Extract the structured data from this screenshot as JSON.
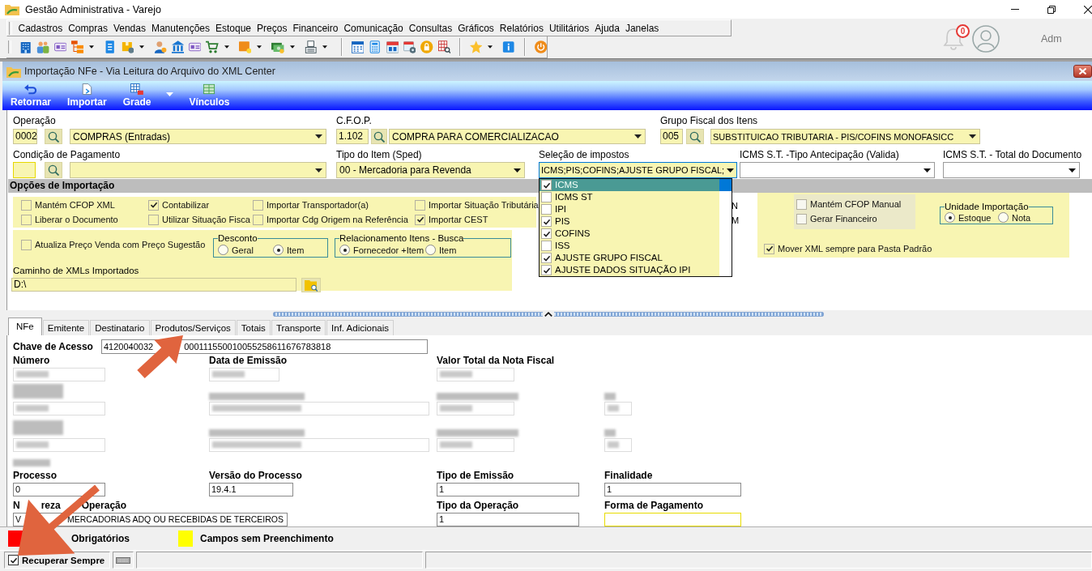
{
  "app": {
    "title": "Gestão Administrativa - Varejo"
  },
  "menu": [
    "Cadastros",
    "Compras",
    "Vendas",
    "Manutenções",
    "Estoque",
    "Preços",
    "Financeiro",
    "Comunicação",
    "Consultas",
    "Gráficos",
    "Relatórios",
    "Utilitários",
    "Ajuda",
    "Janelas"
  ],
  "notifications": {
    "count": "0"
  },
  "user": {
    "name": "Adm"
  },
  "window": {
    "title": "Importação NFe - Via Leitura do Arquivo do XML Center"
  },
  "actions": [
    {
      "label": "Retornar",
      "dropdown": false
    },
    {
      "label": "Importar",
      "dropdown": false
    },
    {
      "label": "Grade",
      "dropdown": true
    },
    {
      "label": "Vínculos",
      "dropdown": false
    }
  ],
  "operacao": {
    "label": "Operação",
    "code": "0002",
    "value": "COMPRAS (Entradas)"
  },
  "cfop": {
    "label": "C.F.O.P.",
    "code": "1.102",
    "value": "COMPRA PARA COMERCIALIZACAO"
  },
  "grupo_fiscal": {
    "label": "Grupo Fiscal dos Itens",
    "code": "005",
    "value": "SUBSTITUICAO TRIBUTARIA - PIS/COFINS MONOFASICC"
  },
  "condicao_pagamento": {
    "label": "Condição de Pagamento"
  },
  "tipo_item": {
    "label": "Tipo do Item (Sped)",
    "value": "00 - Mercadoria para Revenda"
  },
  "impostos": {
    "label": "Seleção de impostos",
    "value": "ICMS;PIS;COFINS;AJUSTE GRUPO FISCAL;",
    "expanded": true,
    "options": [
      {
        "label": "ICMS",
        "checked": true,
        "selected": true
      },
      {
        "label": "ICMS ST",
        "checked": false,
        "selected": false
      },
      {
        "label": "IPI",
        "checked": false,
        "selected": false
      },
      {
        "label": "PIS",
        "checked": true,
        "selected": false
      },
      {
        "label": "COFINS",
        "checked": true,
        "selected": false
      },
      {
        "label": "ISS",
        "checked": false,
        "selected": false
      },
      {
        "label": "AJUSTE GRUPO FISCAL",
        "checked": true,
        "selected": false
      },
      {
        "label": "AJUSTE DADOS SITUAÇÃO IPI",
        "checked": true,
        "selected": false
      }
    ]
  },
  "icms_st_tipo": {
    "label": "ICMS S.T. -Tipo Antecipação (Valida)"
  },
  "icms_st_total": {
    "label": "ICMS S.T. - Total do Documento"
  },
  "opcoes": {
    "title": "Opções de Importação",
    "checks": [
      {
        "label": "Mantém CFOP XML",
        "checked": false
      },
      {
        "label": "Contabilizar",
        "checked": true
      },
      {
        "label": "Importar Transportador(a)",
        "checked": false
      },
      {
        "label": "Importar Situação Tributária",
        "checked": false
      },
      {
        "label": "Liberar o Documento",
        "checked": false
      },
      {
        "label": "Utilizar Situação Fisca",
        "checked": false
      },
      {
        "label": "Importar Cdg Origem na Referência",
        "checked": false
      },
      {
        "label": "Importar CEST",
        "checked": true
      }
    ],
    "column_5_fragments": [
      "N",
      "M"
    ],
    "extra_checks": [
      {
        "label": "Mantém CFOP Manual",
        "checked": false
      },
      {
        "label": "Gerar Financeiro",
        "checked": false
      }
    ],
    "unidade": {
      "title": "Unidade Importação",
      "options": [
        {
          "label": "Estoque",
          "selected": true
        },
        {
          "label": "Nota",
          "selected": false
        }
      ]
    },
    "mover_xml": {
      "label": "Mover XML sempre para Pasta Padrão",
      "checked": true
    },
    "atualiza_preco": {
      "label": "Atualiza Preço Venda com Preço Sugestão",
      "checked": false
    },
    "desconto": {
      "title": "Desconto",
      "options": [
        {
          "label": "Geral",
          "selected": false
        },
        {
          "label": "Item",
          "selected": true
        }
      ]
    },
    "relacionamento": {
      "title": "Relacionamento Itens - Busca",
      "options": [
        {
          "label": "Fornecedor +Item",
          "selected": true
        },
        {
          "label": "Item",
          "selected": false
        }
      ]
    },
    "caminho": {
      "label": "Caminho de XMLs Importados",
      "value": "D:\\"
    }
  },
  "tabs": [
    {
      "label": "NFe",
      "selected": true
    },
    {
      "label": "Emitente",
      "selected": false
    },
    {
      "label": "Destinatario",
      "selected": false
    },
    {
      "label": "Produtos/Serviços",
      "selected": false
    },
    {
      "label": "Totais",
      "selected": false
    },
    {
      "label": "Transporte",
      "selected": false
    },
    {
      "label": "Inf. Adicionais",
      "selected": false
    }
  ],
  "nfe": {
    "chave": {
      "label": "Chave de Acesso",
      "value_parts": [
        "4120040032",
        "000111550010055258611676783818"
      ]
    },
    "top_labels": [
      "Número",
      "Data de Emissão",
      "Valor Total da Nota Fiscal"
    ],
    "fields": [
      {
        "label": "Processo",
        "value": "0"
      },
      {
        "label": "Versão do Processo",
        "value": "19.4.1"
      },
      {
        "label": "Tipo de Emissão",
        "value": "1"
      },
      {
        "label": "Finalidade",
        "value": "1"
      }
    ],
    "natureza": {
      "label_parts": [
        "N",
        "reza",
        "Operação"
      ],
      "value_parts": [
        "V",
        "MERCADORIAS ADQ OU RECEBIDAS DE TERCEIROS"
      ]
    },
    "tipo_operacao": {
      "label": "Tipo da Operação",
      "value": "1"
    },
    "forma_pagamento": {
      "label": "Forma de Pagamento",
      "unfilled": true
    }
  },
  "legend": [
    {
      "label": "Obrigatórios",
      "color": "#ff0000"
    },
    {
      "label": "Campos sem Preenchimento",
      "color": "#ffff00"
    }
  ],
  "status": {
    "label": "Recuperar Sempre",
    "checked": true
  }
}
